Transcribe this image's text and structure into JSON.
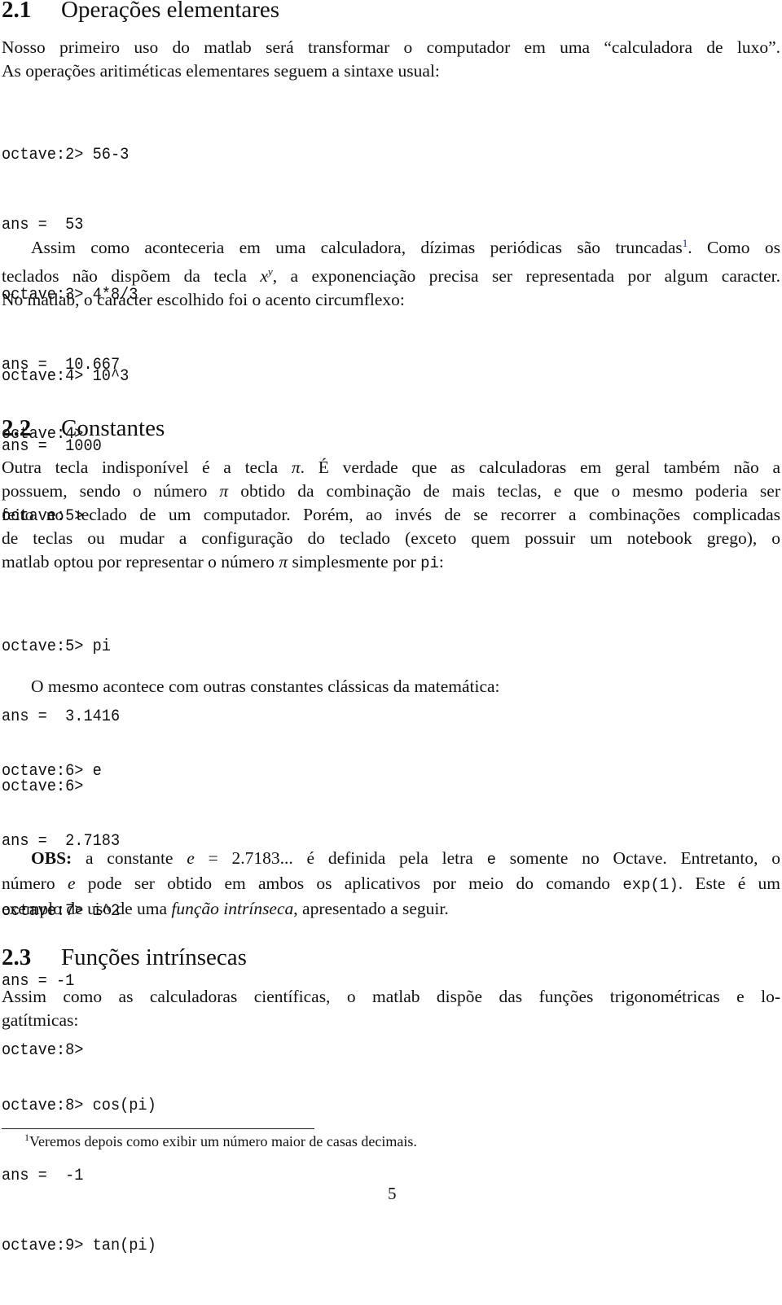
{
  "sections": {
    "s21": {
      "number": "2.1",
      "title": "Operações elementares",
      "intro": {
        "line1": "Nosso primeiro uso do matlab será transformar o computador em uma “calculadora de luxo”.",
        "line2": "As operações aritiméticas elementares seguem a sintaxe usual:"
      },
      "code1": [
        "octave:2> 56-3",
        "ans =  53",
        "octave:3> 4*8/3",
        "ans =  10.667",
        "octave:4>"
      ],
      "para2": {
        "line1_a": "Assim como aconteceria em uma calculadora, dízimas periódicas são truncadas",
        "footnote_marker": "1",
        "line1_b": ".  Como os",
        "line2_a": "teclados não dispõem da tecla ",
        "line2_math_x": "x",
        "line2_math_y": "y",
        "line2_b": ", a exponenciação precisa ser representada por algum caracter.",
        "line3": "No matlab, o caracter escolhido foi o acento circumflexo:"
      },
      "code2": [
        "octave:4> 10^3",
        "ans =  1000",
        "octave:5>"
      ]
    },
    "s22": {
      "number": "2.2",
      "title": "Constantes",
      "para1": {
        "line1_a": "Outra tecla indisponível é a tecla ",
        "pi": "π",
        "line1_b": ".  É verdade que as calculadoras em geral também não a",
        "line2_a": "possuem, sendo o número ",
        "line2_b": " obtido da combinação de mais teclas, e que o mesmo poderia ser",
        "line3": "feito no teclado de um computador.  Porém, ao invés de se recorrer a combinações complicadas",
        "line4": "de teclas ou mudar a configuração do teclado (exceto quem possuir um notebook grego), o",
        "line5_a": "matlab optou por representar o número ",
        "line5_b": " simplesmente por ",
        "line5_code": "pi",
        "line5_c": ":"
      },
      "code1": [
        "octave:5> pi",
        "ans =  3.1416",
        "octave:6>"
      ],
      "para2": "O mesmo acontece com outras constantes clássicas da matemática:",
      "code2": [
        "octave:6> e",
        "ans =  2.7183",
        "octave:7> i^2",
        "ans = -1",
        "octave:8>"
      ],
      "obs": {
        "label": "OBS:",
        "line1_a": " a constante ",
        "e": "e",
        "line1_b": " = 2.7183... é definida pela letra ",
        "line1_code": "e",
        "line1_c": " somente no Octave.  Entretanto, o",
        "line2_a": "número ",
        "line2_b": " pode ser obtido em ambos os aplicativos por meio do comando ",
        "line2_code": "exp(1)",
        "line2_c": ".  Este é um",
        "line3_a": "exemplo de uso de uma ",
        "line3_italic": "função intrínseca",
        "line3_b": ", apresentado a seguir."
      }
    },
    "s23": {
      "number": "2.3",
      "title": "Funções intrínsecas",
      "para1": {
        "line1": "Assim como as calculadoras científicas, o matlab dispõe das funções trigonométricas e lo-",
        "line2": "gatítmicas:"
      },
      "code1": [
        "octave:8> cos(pi)",
        "ans =  -1",
        "octave:9> tan(pi)"
      ]
    }
  },
  "footnote": {
    "marker": "1",
    "text": "Veremos depois como exibir um número maior de casas decimais."
  },
  "page_number": "5",
  "colors": {
    "footnote_marker": "#1a1a8c",
    "text": "#111111"
  }
}
